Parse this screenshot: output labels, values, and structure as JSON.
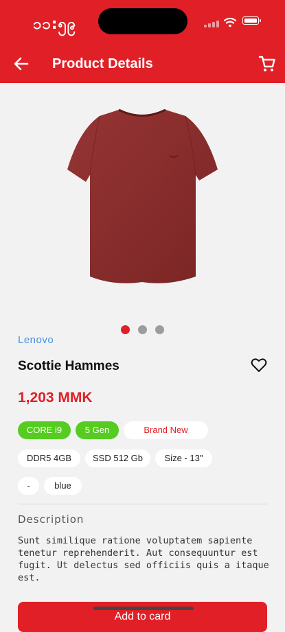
{
  "status_bar": {
    "time": "၁၁:၅၉"
  },
  "header": {
    "title": "Product Details"
  },
  "product": {
    "brand": "Lenovo",
    "name": "Scottie Hammes",
    "price": "1,203 MMK",
    "image_color": "#8a2c2c",
    "carousel": {
      "total": 3,
      "active": 1
    },
    "tags": [
      {
        "label": "CORE i9",
        "style": "green"
      },
      {
        "label": "5 Gen",
        "style": "green"
      },
      {
        "label": "Brand New",
        "style": "outline"
      },
      {
        "label": "DDR5 4GB",
        "style": "white"
      },
      {
        "label": "SSD 512 Gb",
        "style": "white"
      },
      {
        "label": "Size - 13\"",
        "style": "white"
      },
      {
        "label": "-",
        "style": "white"
      },
      {
        "label": "blue",
        "style": "white"
      }
    ],
    "description_label": "Description",
    "description": "Sunt similique ratione voluptatem sapiente tenetur reprehenderit. Aut consequuntur est fugit. Ut delectus sed officiis quis a itaque est."
  },
  "actions": {
    "add_to_cart": "Add to card"
  },
  "colors": {
    "brand_red": "#e01f26",
    "tag_green": "#55cc1f",
    "link_blue": "#4a8fe0"
  }
}
